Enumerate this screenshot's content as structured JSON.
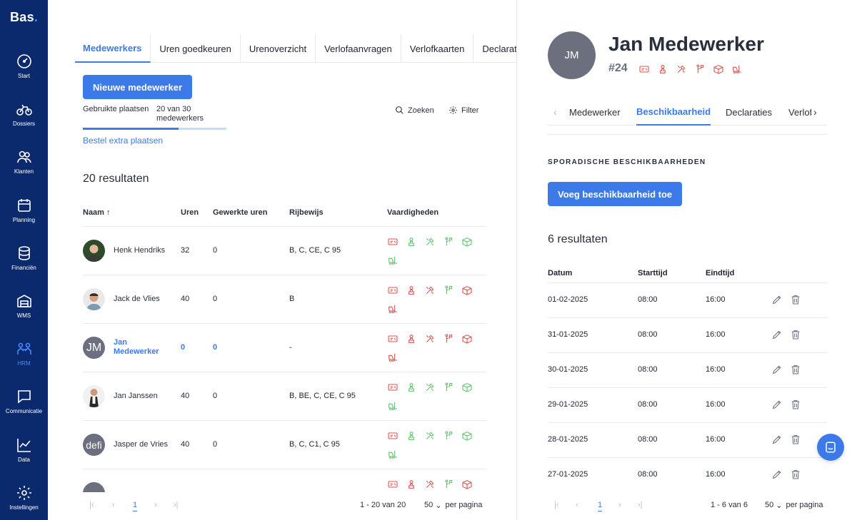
{
  "brand": {
    "name": "Bas",
    "dot": "."
  },
  "sidebar": {
    "items": [
      {
        "label": "Start",
        "icon": "gauge-icon"
      },
      {
        "label": "Dossiers",
        "icon": "bikes-icon"
      },
      {
        "label": "Klanten",
        "icon": "customers-icon"
      },
      {
        "label": "Planning",
        "icon": "calendar-icon"
      },
      {
        "label": "Financiën",
        "icon": "coins-icon"
      },
      {
        "label": "WMS",
        "icon": "warehouse-icon"
      },
      {
        "label": "HRM",
        "icon": "people-icon",
        "active": true
      },
      {
        "label": "Communicatie",
        "icon": "chat-icon"
      },
      {
        "label": "Data",
        "icon": "line-chart-icon"
      },
      {
        "label": "Instellingen",
        "icon": "gear-icon"
      }
    ]
  },
  "left": {
    "tabs": [
      "Medewerkers",
      "Uren goedkeuren",
      "Urenoverzicht",
      "Verlofaanvragen",
      "Verlofkaarten",
      "Declaraties"
    ],
    "new_button": "Nieuwe medewerker",
    "seats_label": "Gebruikte plaatsen",
    "seats_value": "20 van 30 medewerkers",
    "seats_fraction": 0.667,
    "extra_link": "Bestel extra plaatsen",
    "search_label": "Zoeken",
    "filter_label": "Filter",
    "results": "20 resultaten",
    "columns": {
      "naam": "Naam",
      "uren": "Uren",
      "gewerkt": "Gewerkte uren",
      "rijbewijs": "Rijbewijs",
      "vaardigheden": "Vaardigheden"
    },
    "rows": [
      {
        "name": "Henk Hendriks",
        "uren": "32",
        "gewerkt": "0",
        "rijbewijs": "B, C, CE, C 95",
        "avatar": "photo",
        "skills": "green-mixed"
      },
      {
        "name": "Jack de Vlies",
        "uren": "40",
        "gewerkt": "0",
        "rijbewijs": "B",
        "avatar": "photo",
        "skills": "red"
      },
      {
        "name": "Jan Medewerker",
        "uren": "0",
        "gewerkt": "0",
        "rijbewijs": "-",
        "avatar": "JM",
        "skills": "red",
        "active": true
      },
      {
        "name": "Jan Janssen",
        "uren": "40",
        "gewerkt": "0",
        "rijbewijs": "B, BE, C, CE, C 95",
        "avatar": "photo",
        "skills": "green-mixed"
      },
      {
        "name": "Jasper de Vries",
        "uren": "40",
        "gewerkt": "0",
        "rijbewijs": "B, C, C1, C 95",
        "avatar": "defi",
        "skills": "green-mixed"
      }
    ],
    "pager": {
      "current": "1",
      "range": "1 - 20 van 20",
      "per_page": "50",
      "per_page_label": "per pagina"
    }
  },
  "right": {
    "initials": "JM",
    "name": "Jan Medewerker",
    "id": "#24",
    "tabs": [
      "Medewerker",
      "Beschikbaarheid",
      "Declaraties",
      "Verlof"
    ],
    "section_title": "SPORADISCHE BESCHIKBAARHEDEN",
    "add_button": "Voeg beschikbaarheid toe",
    "results": "6 resultaten",
    "columns": {
      "datum": "Datum",
      "start": "Starttijd",
      "eind": "Eindtijd"
    },
    "rows": [
      {
        "datum": "01-02-2025",
        "start": "08:00",
        "eind": "16:00"
      },
      {
        "datum": "31-01-2025",
        "start": "08:00",
        "eind": "16:00"
      },
      {
        "datum": "30-01-2025",
        "start": "08:00",
        "eind": "16:00"
      },
      {
        "datum": "29-01-2025",
        "start": "08:00",
        "eind": "16:00"
      },
      {
        "datum": "28-01-2025",
        "start": "08:00",
        "eind": "16:00"
      },
      {
        "datum": "27-01-2025",
        "start": "08:00",
        "eind": "16:00"
      }
    ],
    "pager": {
      "current": "1",
      "range": "1 - 6 van 6",
      "per_page": "50",
      "per_page_label": "per pagina"
    }
  },
  "colors": {
    "sidebar": "#0b2a6e",
    "accent": "#3b7ae8",
    "skill_red": "#d9534f",
    "skill_green": "#5cc46a"
  }
}
